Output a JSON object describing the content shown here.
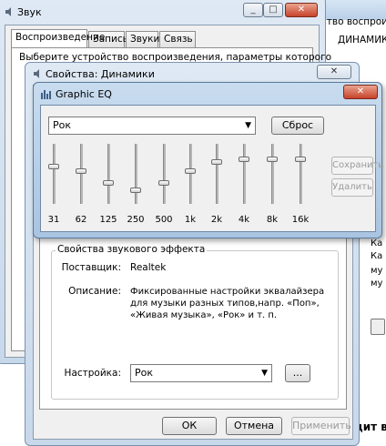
{
  "sound_window": {
    "title": "Звук",
    "tabs": [
      "Воспроизведение",
      "Запись",
      "Звуки",
      "Связь"
    ],
    "instruction": "Выберите устройство воспроизведения, параметры которого"
  },
  "background_window": {
    "line1": "ство воспроиз",
    "line2": "ДИНАМИКИ",
    "side_text_1": "Ка",
    "side_text_2": "Ка",
    "side_text_3": "му",
    "side_text_4": "му",
    "bottom_text": "дит в"
  },
  "properties_window": {
    "title": "Свойства: Динамики",
    "group_label": "Свойства звукового эффекта",
    "provider_label": "Поставщик:",
    "provider_value": "Realtek",
    "description_label": "Описание:",
    "description_value": "Фиксированные настройки эквалайзера для музыки разных типов,напр. «Поп», «Живая музыка», «Рок» и т. п.",
    "setting_label": "Настройка:",
    "setting_value": "Рок",
    "more_button": "...",
    "ok_button": "ОК",
    "cancel_button": "Отмена",
    "apply_button": "Применить"
  },
  "eq_window": {
    "title": "Graphic EQ",
    "preset": "Рок",
    "reset_button": "Сброс",
    "save_button": "Сохранить",
    "delete_button": "Удалить",
    "bands": [
      {
        "freq": "31",
        "level": 0.62
      },
      {
        "freq": "62",
        "level": 0.55
      },
      {
        "freq": "125",
        "level": 0.35
      },
      {
        "freq": "250",
        "level": 0.22
      },
      {
        "freq": "500",
        "level": 0.35
      },
      {
        "freq": "1k",
        "level": 0.55
      },
      {
        "freq": "2k",
        "level": 0.7
      },
      {
        "freq": "4k",
        "level": 0.75
      },
      {
        "freq": "8k",
        "level": 0.75
      },
      {
        "freq": "16k",
        "level": 0.75
      }
    ]
  },
  "icons": {
    "close": "close-icon",
    "minimize": "minimize-icon",
    "maximize": "maximize-icon",
    "speaker": "speaker-icon",
    "eq": "equalizer-icon",
    "dropdown": "chevron-down-icon"
  }
}
